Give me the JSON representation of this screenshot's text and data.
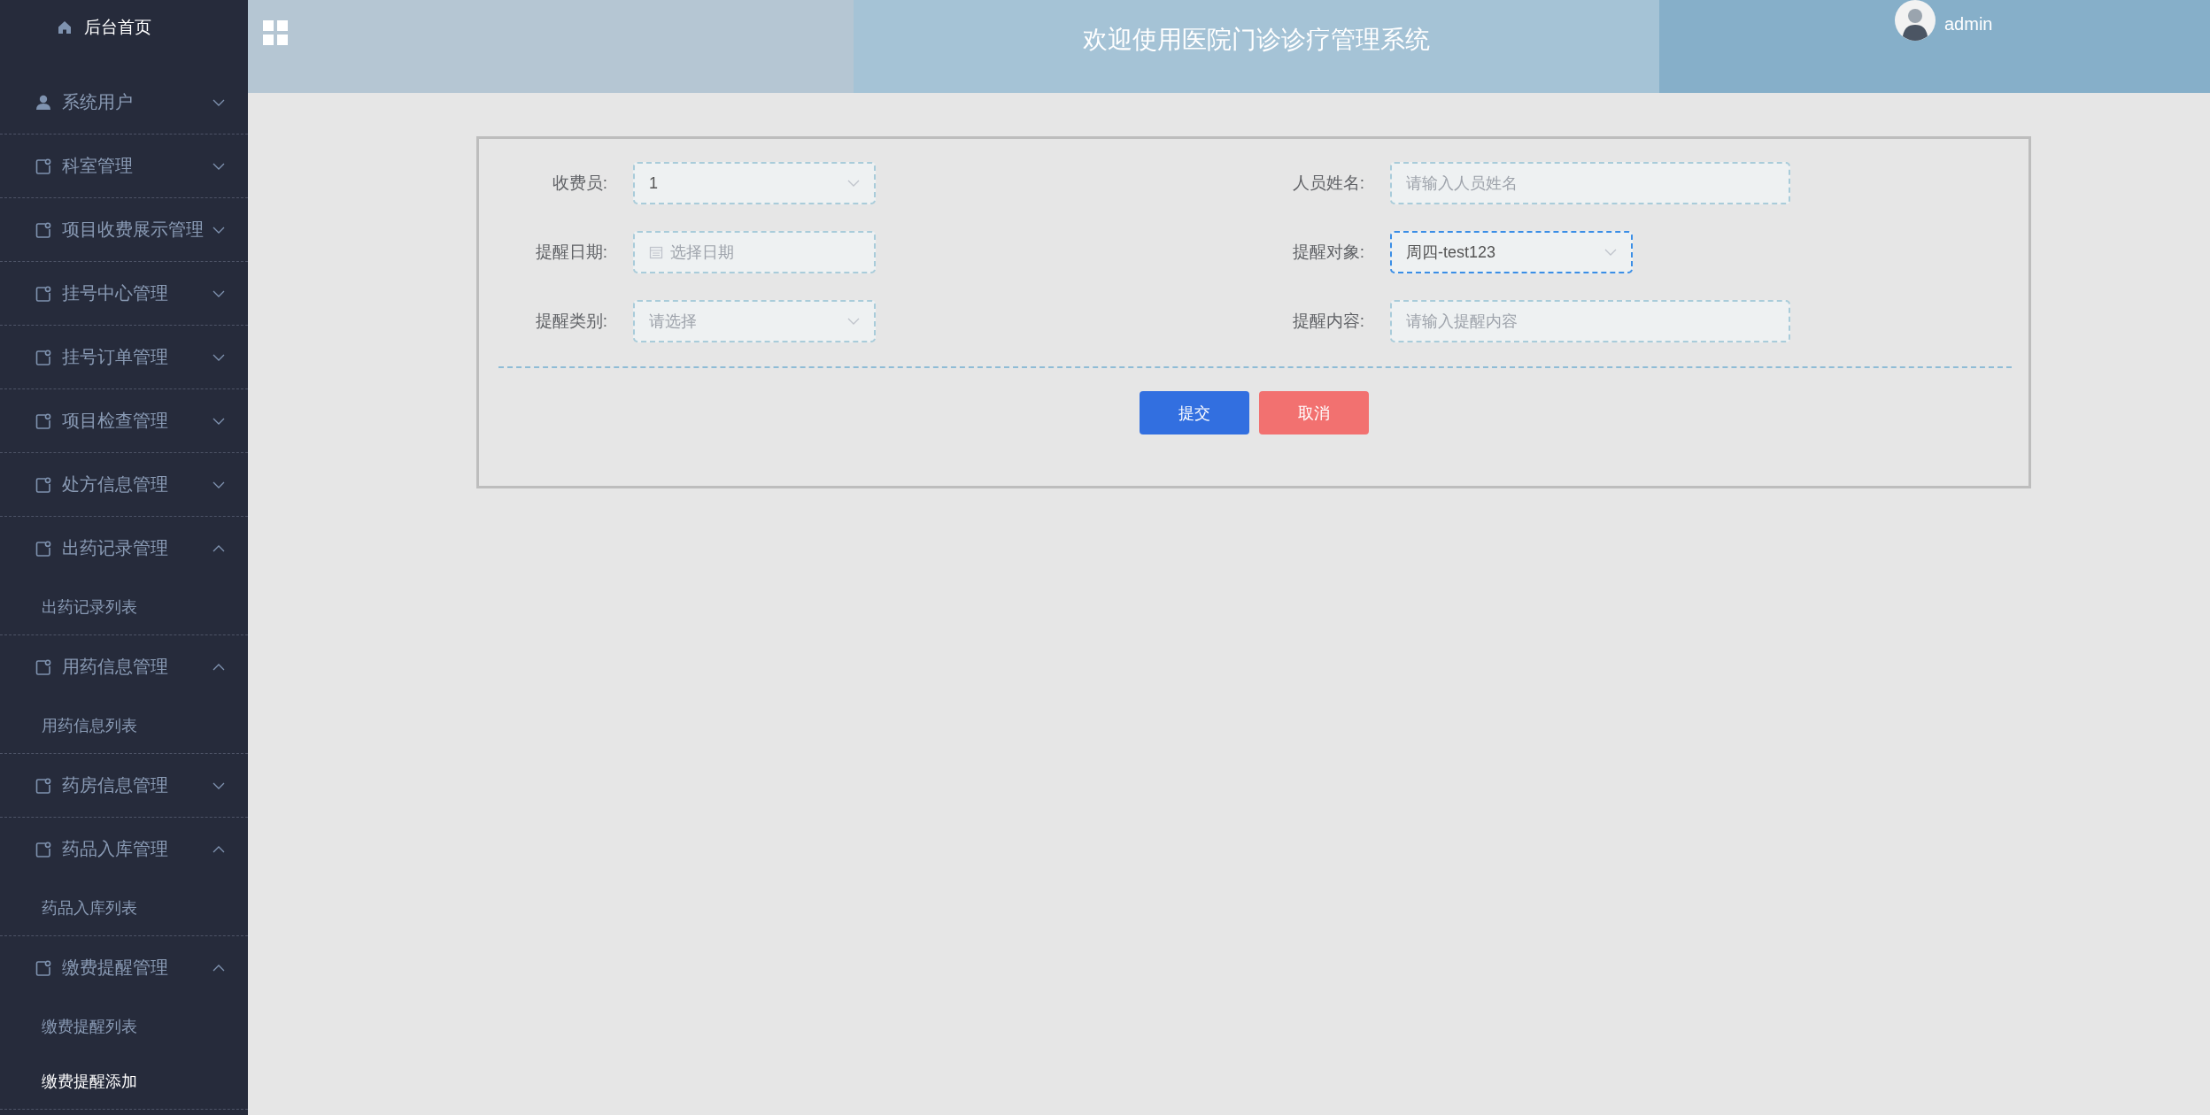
{
  "sidebar": {
    "home": {
      "label": "后台首页"
    },
    "groups": [
      {
        "label": "系统用户",
        "expanded": false
      },
      {
        "label": "科室管理",
        "expanded": false
      },
      {
        "label": "项目收费展示管理",
        "expanded": false
      },
      {
        "label": "挂号中心管理",
        "expanded": false
      },
      {
        "label": "挂号订单管理",
        "expanded": false
      },
      {
        "label": "项目检查管理",
        "expanded": false
      },
      {
        "label": "处方信息管理",
        "expanded": false
      },
      {
        "label": "出药记录管理",
        "expanded": true,
        "children": [
          {
            "label": "出药记录列表",
            "selected": false
          }
        ]
      },
      {
        "label": "用药信息管理",
        "expanded": true,
        "children": [
          {
            "label": "用药信息列表",
            "selected": false
          }
        ]
      },
      {
        "label": "药房信息管理",
        "expanded": false
      },
      {
        "label": "药品入库管理",
        "expanded": true,
        "children": [
          {
            "label": "药品入库列表",
            "selected": false
          }
        ]
      },
      {
        "label": "缴费提醒管理",
        "expanded": true,
        "children": [
          {
            "label": "缴费提醒列表",
            "selected": false
          },
          {
            "label": "缴费提醒添加",
            "selected": true
          }
        ]
      }
    ]
  },
  "header": {
    "title": "欢迎使用医院门诊诊疗管理系统",
    "user": "admin"
  },
  "form": {
    "fields": [
      {
        "label": "收费员:",
        "kind": "select",
        "value": "1",
        "focused": false
      },
      {
        "label": "人员姓名:",
        "kind": "text",
        "placeholder": "请输入人员姓名",
        "focused": false
      },
      {
        "label": "提醒日期:",
        "kind": "date",
        "placeholder": "选择日期",
        "focused": false
      },
      {
        "label": "提醒对象:",
        "kind": "select",
        "value": "周四-test123",
        "focused": true
      },
      {
        "label": "提醒类别:",
        "kind": "select",
        "placeholder": "请选择",
        "focused": false
      },
      {
        "label": "提醒内容:",
        "kind": "text",
        "placeholder": "请输入提醒内容",
        "focused": false
      }
    ],
    "buttons": [
      {
        "label": "提交",
        "kind": "primary"
      },
      {
        "label": "取消",
        "kind": "danger"
      }
    ]
  }
}
